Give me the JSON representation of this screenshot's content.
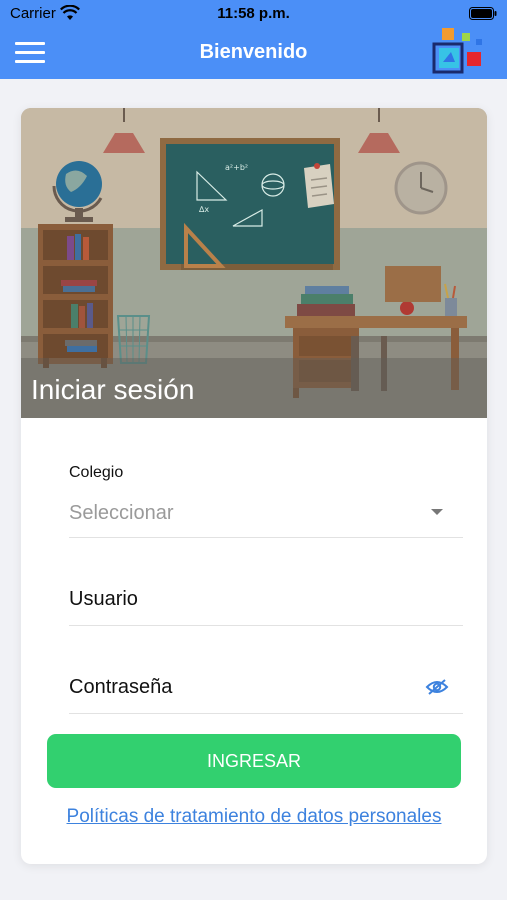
{
  "status_bar": {
    "carrier": "Carrier",
    "time": "11:58 p.m."
  },
  "navbar": {
    "title": "Bienvenido",
    "menu_icon": "hamburger-icon",
    "logo_icon": "app-logo"
  },
  "hero": {
    "title": "Iniciar sesión",
    "image": "classroom-illustration"
  },
  "form": {
    "school_label": "Colegio",
    "school_value": "Seleccionar",
    "username_placeholder": "Usuario",
    "password_placeholder": "Contraseña",
    "password_visibility_icon": "eye-slash-icon"
  },
  "actions": {
    "login_label": "INGRESAR",
    "privacy_link": "Políticas de tratamiento de datos personales"
  },
  "colors": {
    "primary": "#4b8ff7",
    "button": "#32d06f",
    "link": "#3d82de",
    "background": "#f1f2f6"
  }
}
